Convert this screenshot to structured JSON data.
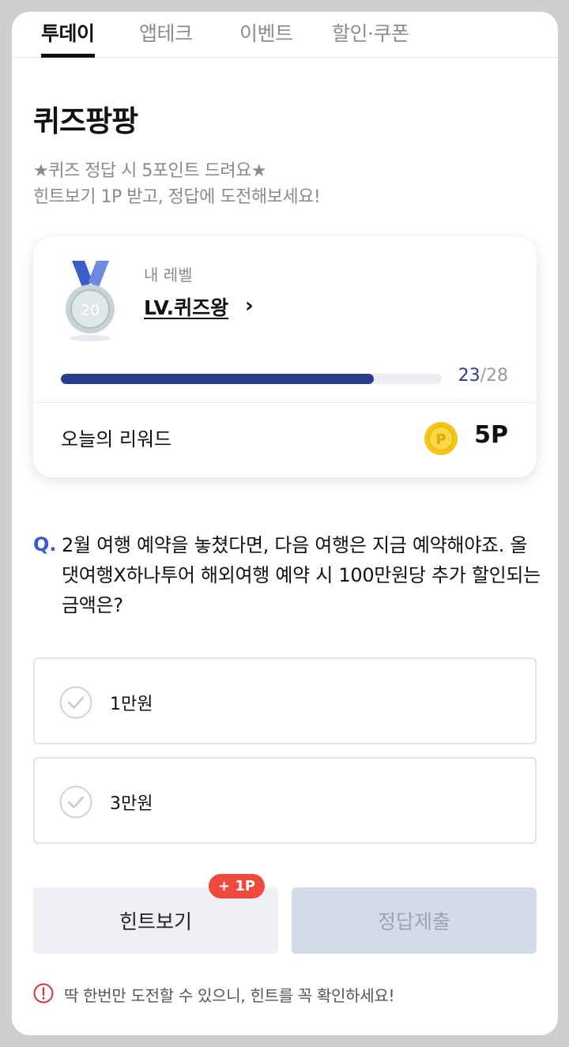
{
  "tabs": [
    {
      "label": "투데이",
      "active": true
    },
    {
      "label": "앱테크",
      "active": false
    },
    {
      "label": "이벤트",
      "active": false
    },
    {
      "label": "할인·쿠폰",
      "active": false
    }
  ],
  "header": {
    "title": "퀴즈팡팡",
    "subtitle_line1": "★퀴즈 정답 시 5포인트 드려요★",
    "subtitle_line2": "힌트보기 1P 받고, 정답에 도전해보세요!"
  },
  "level": {
    "label": "내 레벨",
    "name": "LV.퀴즈왕",
    "medal_number": "20",
    "medal_icon": "medal-icon",
    "progress_current": "23",
    "progress_total": "/28",
    "progress_fraction": 0.8214
  },
  "reward": {
    "label": "오늘의 리워드",
    "value": "5P",
    "coin_icon": "coin-icon"
  },
  "question": {
    "prefix": "Q.",
    "text": "2월 여행 예약을 놓쳤다면, 다음 여행은 지금 예약해야죠. 올댓여행X하나투어 해외여행 예약 시 100만원당 추가 할인되는 금액은?"
  },
  "options": [
    {
      "label": "1만원"
    },
    {
      "label": "3만원"
    }
  ],
  "buttons": {
    "hint_label": "힌트보기",
    "hint_badge": "+ 1P",
    "submit_label": "정답제출"
  },
  "notice": {
    "text": "딱 한번만 도전할 수 있으니, 힌트를 꼭 확인하세요!"
  },
  "colors": {
    "accent": "#2b3d8f",
    "question_mark": "#3a5bd1",
    "badge": "#f04a3e",
    "coin": "#f5c518"
  }
}
